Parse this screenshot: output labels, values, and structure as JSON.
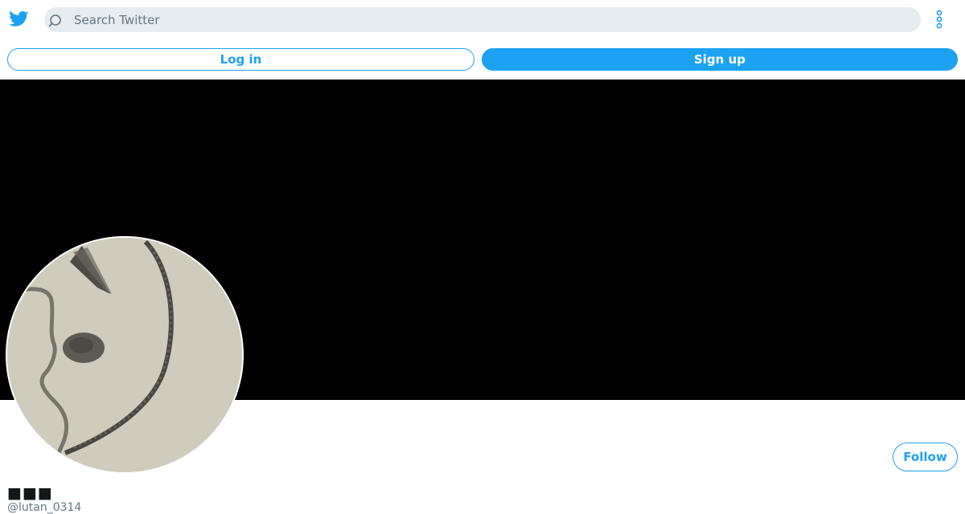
{
  "header": {
    "logo_icon": "twitter-bird-icon",
    "search_placeholder": "Search Twitter",
    "search_value": "",
    "more_icon": "more-vertical-icon"
  },
  "auth": {
    "login_label": "Log in",
    "signup_label": "Sign up"
  },
  "profile": {
    "avatar_icon": "profile-photo",
    "follow_label": "Follow",
    "display_name": "■■■",
    "handle": "@lutan_0314"
  },
  "colors": {
    "brand": "#1da1f2",
    "search_bg": "#e6ecf0",
    "banner": "#000000",
    "text_secondary": "#657786"
  }
}
